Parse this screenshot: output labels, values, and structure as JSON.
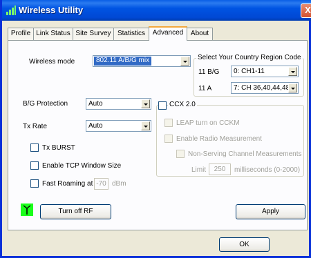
{
  "window": {
    "title": "Wireless Utility",
    "close_glyph": "X"
  },
  "tabs": [
    {
      "label": "Profile"
    },
    {
      "label": "Link Status"
    },
    {
      "label": "Site Survey"
    },
    {
      "label": "Statistics"
    },
    {
      "label": "Advanced"
    },
    {
      "label": "About"
    }
  ],
  "active_tab": "Advanced",
  "advanced": {
    "wireless_mode": {
      "label": "Wireless mode",
      "value": "802.11 A/B/G mix"
    },
    "country_region": {
      "title": "Select Your Country Region Code",
      "bg_label": "11 B/G",
      "bg_value": "0: CH1-11",
      "a_label": "11 A",
      "a_value": "7: CH 36,40,44,48,5"
    },
    "bg_protection": {
      "label": "B/G Protection",
      "value": "Auto"
    },
    "tx_rate": {
      "label": "Tx Rate",
      "value": "Auto"
    },
    "tx_burst": {
      "label": "Tx BURST",
      "checked": false
    },
    "tcp_window": {
      "label": "Enable TCP Window Size",
      "checked": false
    },
    "fast_roaming": {
      "label": "Fast Roaming at",
      "value": "-70",
      "unit": "dBm",
      "checked": false
    },
    "ccx": {
      "label": "CCX 2.0",
      "leap": "LEAP turn on CCKM",
      "radio_measurement": "Enable Radio Measurement",
      "non_serving": "Non-Serving Channel Measurements",
      "limit_label": "Limit",
      "limit_value": "250",
      "limit_unit": "milliseconds (0-2000)"
    },
    "turn_off_rf": "Turn off RF",
    "apply": "Apply"
  },
  "ok": "OK",
  "colors": {
    "titlebar": "#0054e3",
    "rf_indicator": "#1aff1a",
    "selection": "#316ac5"
  },
  "icons": {
    "title": "wireless-signal-icon",
    "rf": "antenna-icon"
  }
}
